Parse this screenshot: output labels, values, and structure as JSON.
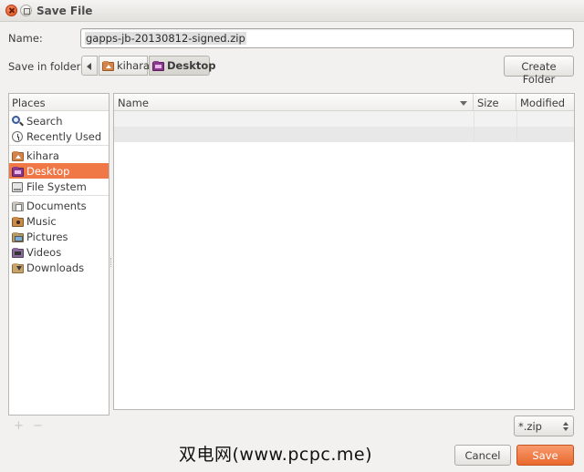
{
  "window": {
    "title": "Save File"
  },
  "name_row": {
    "label": "Name:",
    "value": "gapps-jb-20130812-signed.zip"
  },
  "folder_row": {
    "label": "Save in folder:",
    "path": [
      {
        "label": "kihara",
        "icon": "home-folder-icon"
      },
      {
        "label": "Desktop",
        "icon": "desktop-folder-icon"
      }
    ],
    "create_folder_label": "Create Folder"
  },
  "places": {
    "header": "Places",
    "items": [
      {
        "label": "Search",
        "icon": "search-icon"
      },
      {
        "label": "Recently Used",
        "icon": "clock-icon"
      },
      {
        "label": "kihara",
        "icon": "home-folder-icon"
      },
      {
        "label": "Desktop",
        "icon": "desktop-folder-icon",
        "active": true
      },
      {
        "label": "File System",
        "icon": "drive-icon"
      },
      {
        "label": "Documents",
        "icon": "documents-folder-icon"
      },
      {
        "label": "Music",
        "icon": "music-folder-icon"
      },
      {
        "label": "Pictures",
        "icon": "pictures-folder-icon"
      },
      {
        "label": "Videos",
        "icon": "videos-folder-icon"
      },
      {
        "label": "Downloads",
        "icon": "downloads-folder-icon"
      }
    ],
    "add_symbol": "+",
    "remove_symbol": "−"
  },
  "files": {
    "columns": [
      "Name",
      "Size",
      "Modified"
    ],
    "rows": []
  },
  "filter": {
    "value": "*.zip"
  },
  "buttons": {
    "cancel": "Cancel",
    "save": "Save"
  },
  "watermark": "双电网(www.pcpc.me)",
  "colors": {
    "accent": "#f07746",
    "save_button": "#e9692e"
  }
}
